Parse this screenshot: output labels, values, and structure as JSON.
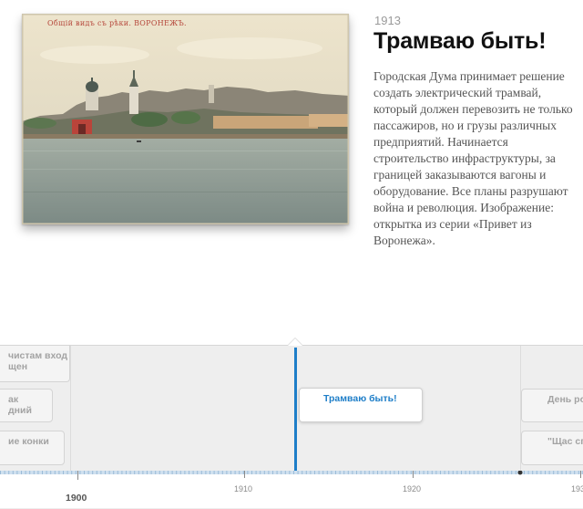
{
  "slide": {
    "postcard_caption": "Общій видъ съ рѣки. ВОРОНЕЖЪ.",
    "year": "1913",
    "title": "Трамваю быть!",
    "description": "Городская Дума принимает решение создать электрический трамвай, который должен перевозить не только пассажиров, но и грузы различных предприятий. Начинается строительство инфраструктуры, за границей заказываются вагоны и оборудование. Все планы разрушают война и революция. Изображение: открытка из серии «Привет из Воронежа»."
  },
  "timeline": {
    "events_left": [
      {
        "line1": "чистам вход",
        "line2": "щен"
      },
      {
        "line1": "ак",
        "line2": "дний"
      },
      {
        "line1": "ие конки",
        "line2": ""
      }
    ],
    "active_event": "Трамваю быть!",
    "events_right": [
      {
        "line1": "День ро",
        "line2": ""
      },
      {
        "line1": "\"Щас сп",
        "line2": ""
      }
    ],
    "tick_labels": [
      "1910",
      "1920",
      "193"
    ],
    "major_label": "1900"
  },
  "colors": {
    "accent": "#1e7ec8",
    "timeline_bg": "#eeeeee"
  }
}
